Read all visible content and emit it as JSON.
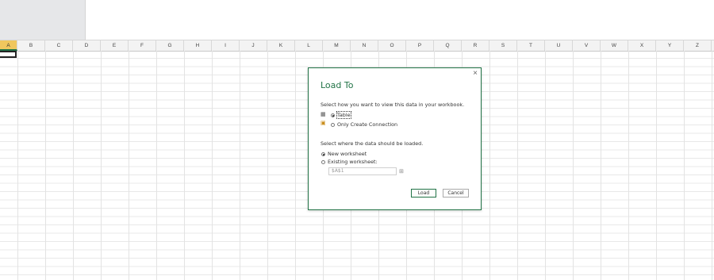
{
  "sheet": {
    "columns": [
      "A",
      "B",
      "C",
      "D",
      "E",
      "F",
      "G",
      "H",
      "I",
      "J",
      "K",
      "L",
      "M",
      "N",
      "O",
      "P",
      "Q",
      "R",
      "S",
      "T",
      "U",
      "V",
      "W",
      "X",
      "Y",
      "Z"
    ],
    "active_column": "A"
  },
  "dialog": {
    "title": "Load To",
    "close_icon": "×",
    "view_prompt": "Select how you want to view this data in your workbook.",
    "options": [
      {
        "label": "Table",
        "selected": true,
        "icon": "table-icon"
      },
      {
        "label": "Only Create Connection",
        "selected": false,
        "icon": "connection-icon"
      }
    ],
    "location_prompt": "Select where the data should be loaded.",
    "locations": [
      {
        "label": "New worksheet",
        "selected": true
      },
      {
        "label": "Existing worksheet:",
        "selected": false
      }
    ],
    "cell_ref": "$A$1",
    "load_label": "Load",
    "cancel_label": "Cancel"
  },
  "colors": {
    "accent": "#217346",
    "header_active": "#f0c75e"
  }
}
